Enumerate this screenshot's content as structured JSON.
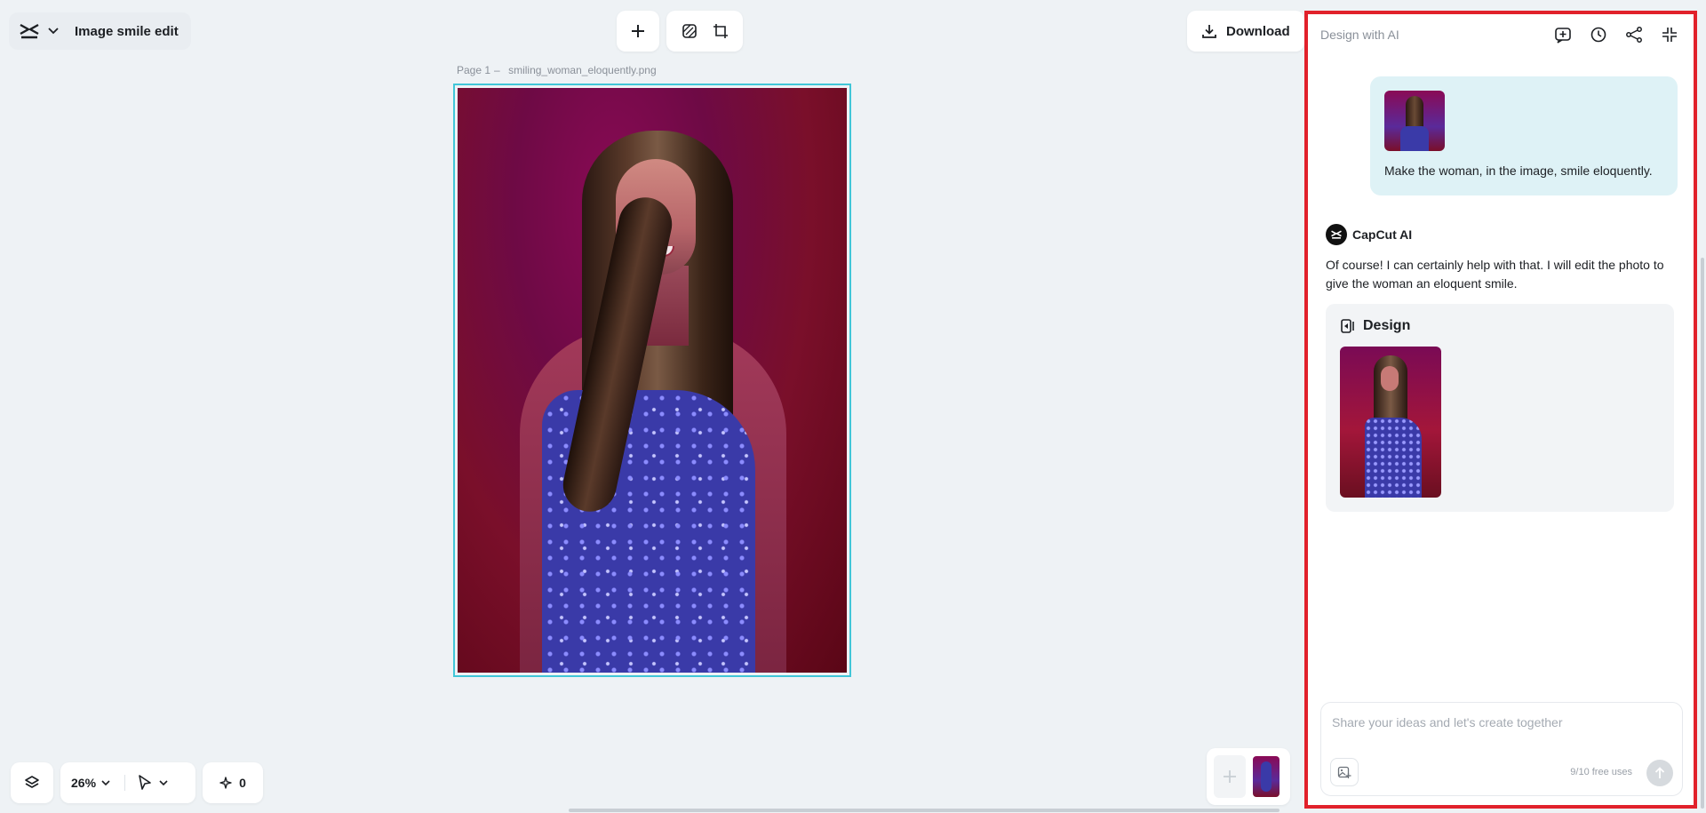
{
  "project": {
    "title": "Image smile edit"
  },
  "toolbar": {
    "download_label": "Download"
  },
  "canvas": {
    "page_label": "Page 1",
    "page_separator": "–",
    "file_name": "smiling_woman_eloquently.png"
  },
  "bottom_bar": {
    "zoom": "26%",
    "ai_count": "0"
  },
  "ai_panel": {
    "title": "Design with AI",
    "user_message": "Make the woman, in the image, smile eloquently.",
    "assistant_name": "CapCut AI",
    "assistant_message": "Of course! I can certainly help with that. I will edit the photo to give the woman an eloquent smile.",
    "design_card_title": "Design",
    "prompt_placeholder": "Share your ideas and let's create together",
    "free_uses": "9/10 free uses"
  },
  "colors": {
    "panel_highlight": "#e1212b",
    "canvas_selection": "#41c6d8",
    "user_bubble": "#def2f6"
  },
  "icons": [
    "capcut-logo-icon",
    "chevron-down-icon",
    "plus-icon",
    "remove-background-icon",
    "crop-resize-icon",
    "download-icon",
    "layers-icon",
    "pointer-icon",
    "sparkle-icon",
    "new-chat-icon",
    "history-icon",
    "share-icon",
    "collapse-icon",
    "design-icon",
    "image-attach-icon",
    "send-arrow-icon"
  ]
}
